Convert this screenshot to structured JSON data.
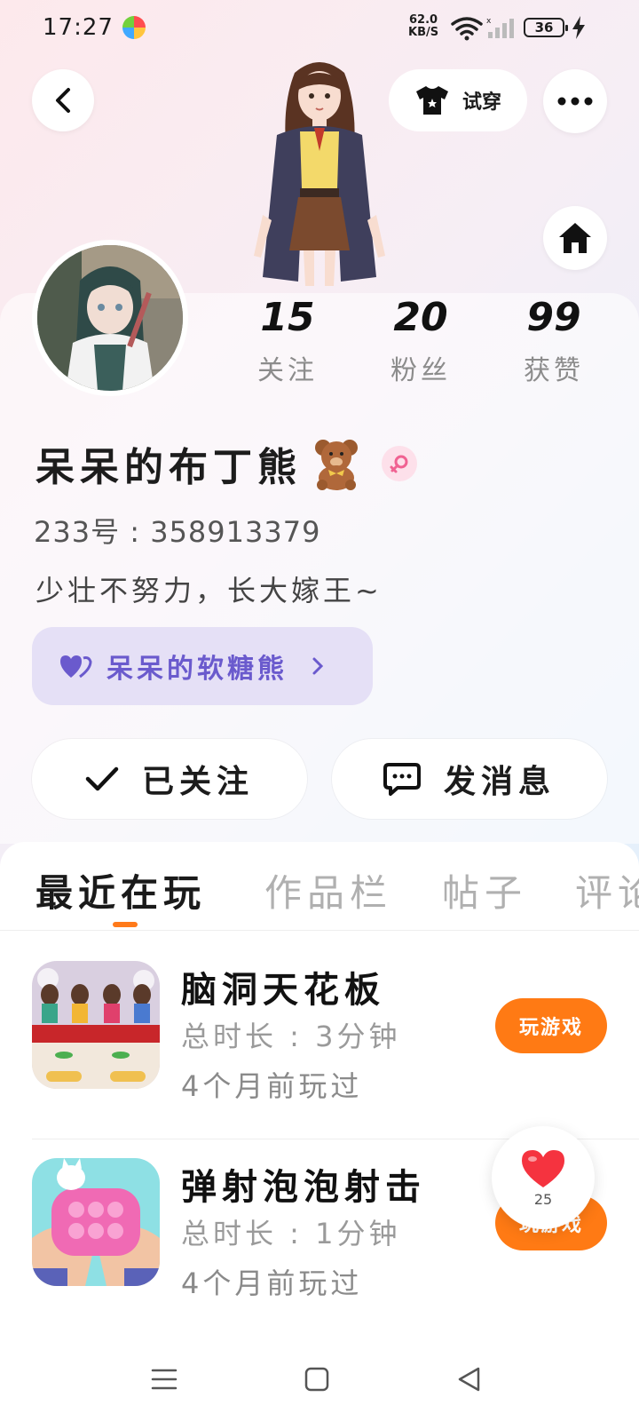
{
  "status_bar": {
    "time": "17:27",
    "net_speed_value": "62.0",
    "net_speed_unit": "KB/S",
    "battery": "36"
  },
  "header": {
    "tryon_label": "试穿"
  },
  "profile": {
    "stats": [
      {
        "value": "15",
        "label": "关注"
      },
      {
        "value": "20",
        "label": "粉丝"
      },
      {
        "value": "99",
        "label": "获赞"
      }
    ],
    "username": "呆呆的布丁熊",
    "uid": "233号 : 358913379",
    "bio": "少壮不努力，长大嫁王~",
    "group_name": "呆呆的软糖熊",
    "follow_label": "已关注",
    "message_label": "发消息"
  },
  "tabs": [
    {
      "label": "最近在玩",
      "active": true
    },
    {
      "label": "作品栏",
      "active": false
    },
    {
      "label": "帖子",
      "active": false
    },
    {
      "label": "评论",
      "active": false
    }
  ],
  "games": [
    {
      "title": "脑洞天花板",
      "duration": "总时长 : 3分钟",
      "last_played": "4个月前玩过",
      "action": "玩游戏"
    },
    {
      "title": "弹射泡泡射击",
      "duration": "总时长 : 1分钟",
      "last_played": "4个月前玩过",
      "action": "玩游戏"
    }
  ],
  "like_float": {
    "count": "25"
  },
  "colors": {
    "accent_orange": "#ff7a14",
    "group_purple": "#6a5acd",
    "heart_red": "#f5333f"
  }
}
